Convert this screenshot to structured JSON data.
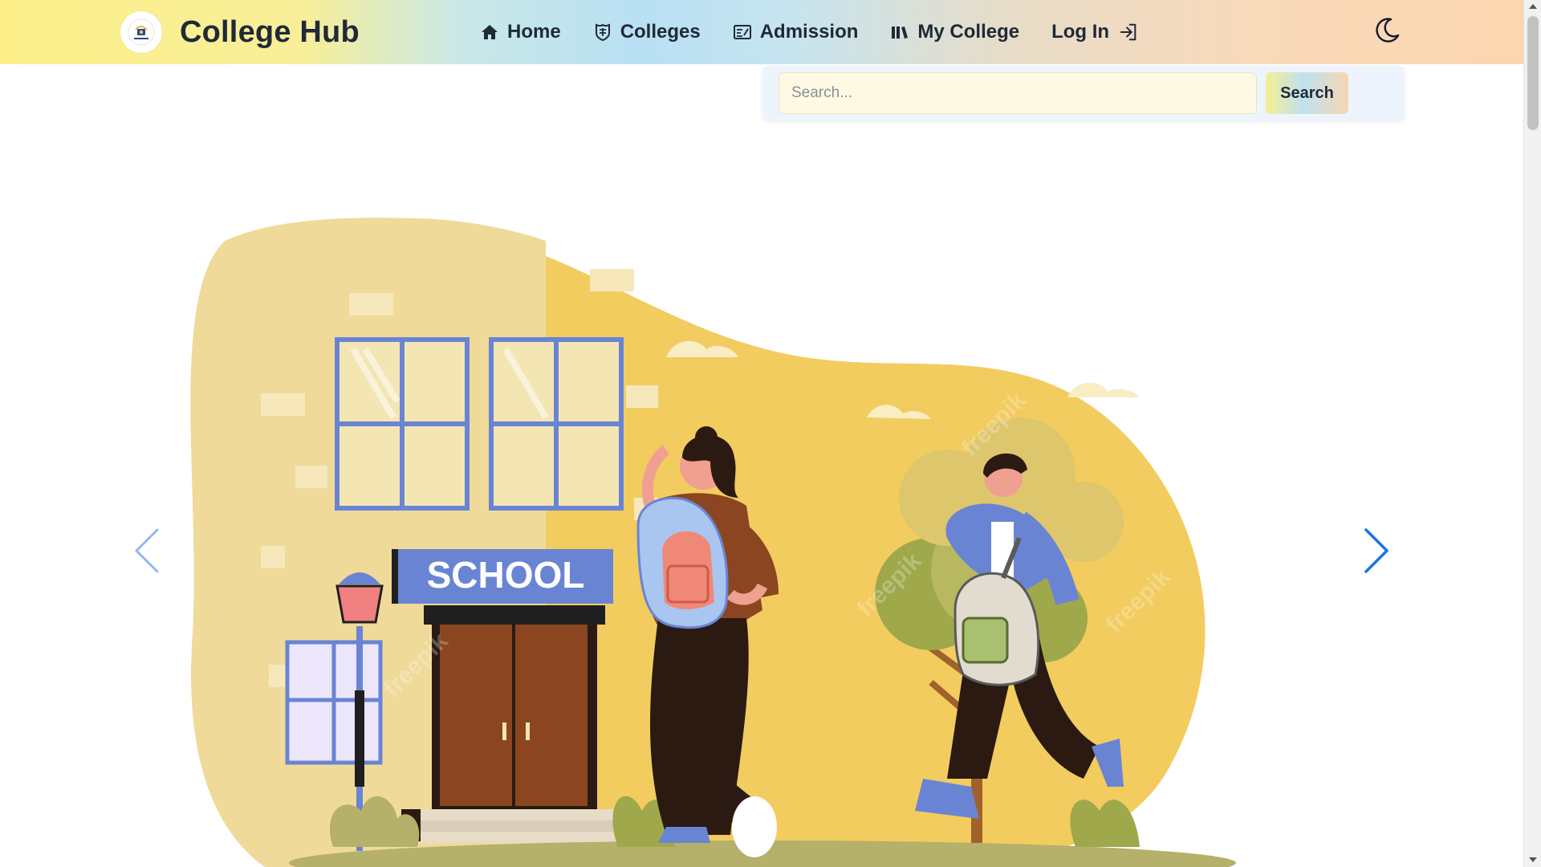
{
  "app": {
    "title": "College Hub"
  },
  "nav": {
    "items": [
      {
        "label": "Home",
        "icon": "home-icon"
      },
      {
        "label": "Colleges",
        "icon": "university-icon"
      },
      {
        "label": "Admission",
        "icon": "admission-icon"
      },
      {
        "label": "My College",
        "icon": "books-icon"
      }
    ],
    "login": {
      "label": "Log In",
      "icon": "login-icon"
    },
    "theme_toggle": {
      "icon": "moon-icon"
    }
  },
  "search": {
    "placeholder": "Search...",
    "value": "",
    "button_label": "Search"
  },
  "hero": {
    "sign_text": "SCHOOL",
    "prev_icon": "chevron-left-icon",
    "next_icon": "chevron-right-icon"
  },
  "colors": {
    "nav_gradient": [
      "#fdf08a",
      "#b9e0f4",
      "#fbd6b0"
    ],
    "text": "#1f2937",
    "illustration_yellow": "#f2cc5f",
    "building": "#f0da9a",
    "sign_blue": "#6a84d4",
    "door_brown": "#8b4520",
    "arrow_blue": "#1a73e8"
  }
}
